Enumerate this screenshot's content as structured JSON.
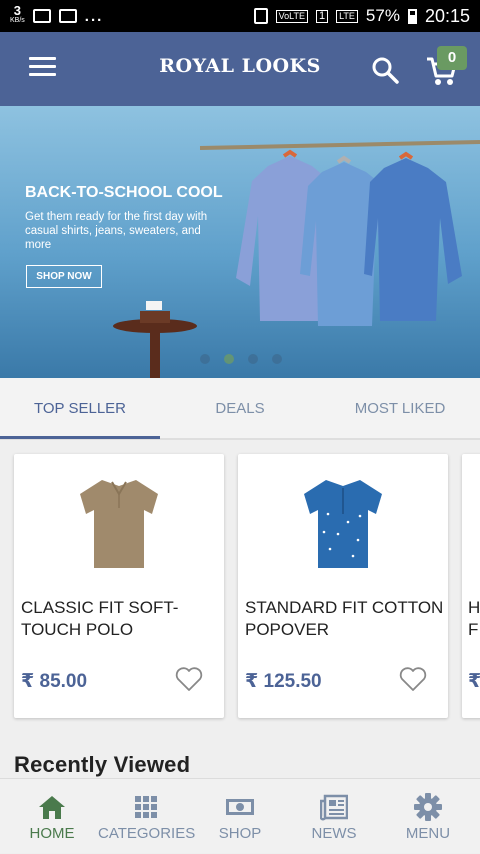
{
  "status_bar": {
    "speed": "3",
    "speed_unit": "KB/s",
    "dots": "...",
    "volte_label": "VoLTE",
    "sim": "1",
    "lte": "LTE",
    "battery": "57%",
    "time": "20:15"
  },
  "header": {
    "brand": "ROYAL LOOKS",
    "cart_count": "0"
  },
  "banner": {
    "title": "BACK-TO-SCHOOL COOL",
    "description": "Get them ready for the first day with casual shirts, jeans, sweaters, and more",
    "cta": "SHOP NOW",
    "slides": 4,
    "active_slide": 1
  },
  "tabs": [
    {
      "label": "TOP SELLER",
      "active": true
    },
    {
      "label": "DEALS",
      "active": false
    },
    {
      "label": "MOST LIKED",
      "active": false
    }
  ],
  "products": [
    {
      "name": "Classic Fit Soft-Touch Polo",
      "price": "₹ 85.00",
      "color": "#a08a6c"
    },
    {
      "name": "Standard Fit Cotton Popover",
      "price": "₹ 125.50",
      "color": "#2a6cb0"
    },
    {
      "name": "H F",
      "price": "₹",
      "color": "#dddddd"
    }
  ],
  "recently_viewed": "Recently Viewed",
  "bottom_nav": [
    {
      "label": "HOME",
      "icon": "home-icon",
      "active": true
    },
    {
      "label": "CATEGORIES",
      "icon": "grid-icon",
      "active": false
    },
    {
      "label": "SHOP",
      "icon": "money-icon",
      "active": false
    },
    {
      "label": "NEWS",
      "icon": "newspaper-icon",
      "active": false
    },
    {
      "label": "MENU",
      "icon": "gear-icon",
      "active": false
    }
  ],
  "colors": {
    "primary": "#4c6396",
    "accent": "#6a9a62",
    "nav_active": "#4a7a4c",
    "nav_inactive": "#7d8fa8"
  }
}
